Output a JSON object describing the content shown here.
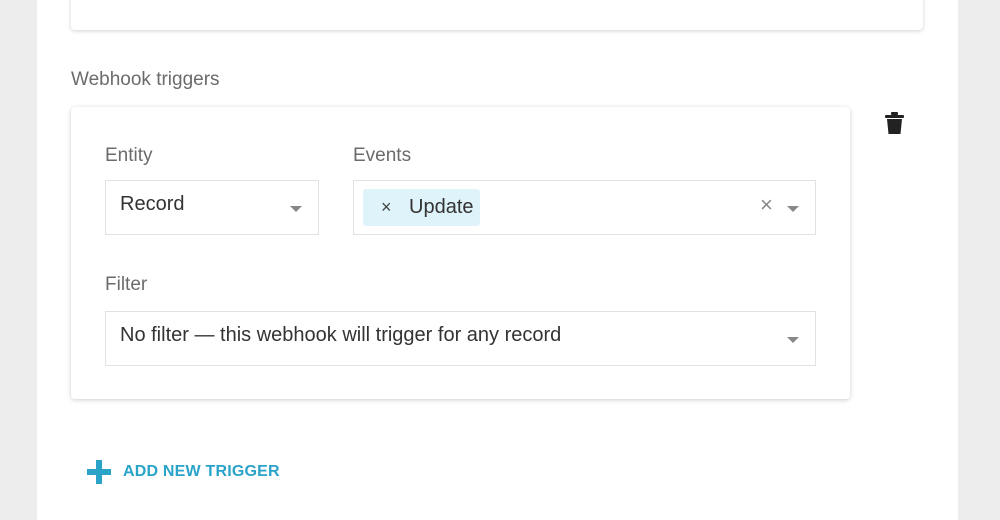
{
  "webhook_triggers": {
    "section_title": "Webhook triggers",
    "trigger": {
      "entity": {
        "label": "Entity",
        "value": "Record"
      },
      "events": {
        "label": "Events",
        "selected": [
          {
            "label": "Update",
            "remove_glyph": "×"
          }
        ],
        "clear_glyph": "×"
      },
      "filter": {
        "label": "Filter",
        "value": "No filter — this webhook will trigger for any record"
      },
      "delete_icon": "trash-icon"
    },
    "add_trigger": {
      "label": "ADD NEW TRIGGER",
      "icon": "plus-icon"
    }
  },
  "colors": {
    "accent": "#2aa3c9",
    "chip_background": "#dff3fa",
    "page_background": "#ededed",
    "card_background": "#ffffff"
  }
}
